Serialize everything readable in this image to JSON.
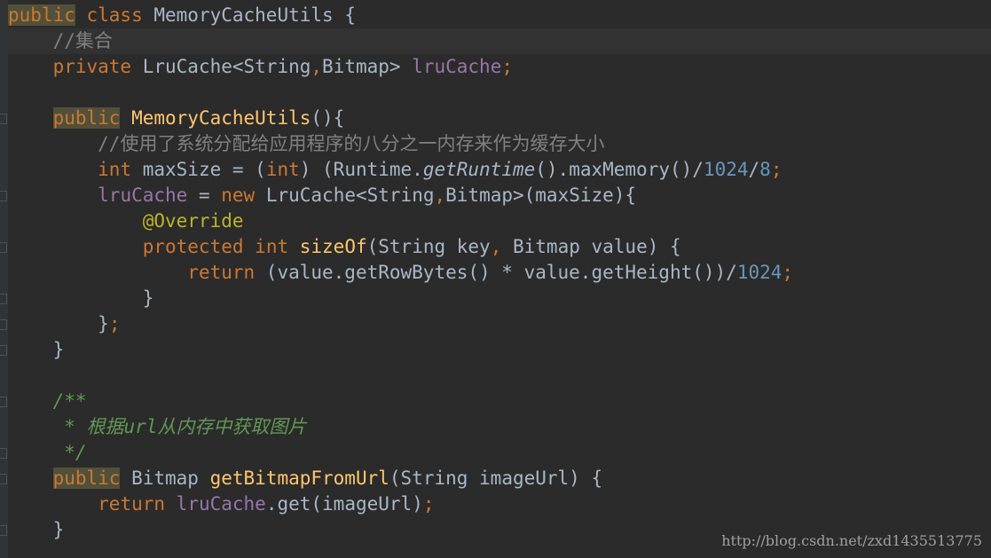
{
  "code": {
    "l1": {
      "kw_public": "public",
      "kw_class": " class ",
      "cls": "MemoryCacheUtils",
      "rest": " {"
    },
    "l2": {
      "comment": "//集合"
    },
    "l3": {
      "kw_private": "private ",
      "type": "LruCache<String",
      "comma": ",",
      "type2": "Bitmap> ",
      "field": "lruCache",
      "semi": ";"
    },
    "l4": {
      "text": ""
    },
    "l5": {
      "kw_public": "public",
      "ctor": " MemoryCacheUtils",
      "rest": "(){"
    },
    "l6": {
      "comment": "//使用了系统分配给应用程序的八分之一内存来作为缓存大小"
    },
    "l7": {
      "kw_int": "int",
      "p1": " maxSize = (",
      "kw_int2": "int",
      "p2": ") (Runtime.",
      "call": "getRuntime",
      "p3": "().maxMemory()/",
      "n1": "1024",
      "slash": "/",
      "n2": "8",
      "semi": ";"
    },
    "l8": {
      "field": "lruCache",
      "p1": " = ",
      "kw_new": "new",
      "p2": " LruCache<String",
      "comma": ",",
      "p3": "Bitmap>(maxSize){"
    },
    "l9": {
      "ann": "@Override"
    },
    "l10": {
      "kw_protected": "protected",
      "sp": " ",
      "kw_int": "int",
      "fn": " sizeOf",
      "p1": "(String key",
      "comma": ",",
      "p2": " Bitmap value) {"
    },
    "l11": {
      "kw_return": "return",
      "p1": " (value.getRowBytes() * value.getHeight())/",
      "num": "1024",
      "semi": ";"
    },
    "l12": {
      "text": "}"
    },
    "l13": {
      "brace": "}",
      "semi": ";"
    },
    "l14": {
      "text": "}"
    },
    "l15": {
      "text": ""
    },
    "l16": {
      "doc": "/**"
    },
    "l17": {
      "doc": " * 根据url从内存中获取图片"
    },
    "l18": {
      "doc": " */"
    },
    "l19": {
      "kw_public": "public",
      "p1": " Bitmap ",
      "fn": "getBitmapFromUrl",
      "p2": "(String imageUrl) {"
    },
    "l20": {
      "kw_return": "return",
      "sp": " ",
      "field": "lruCache",
      "p1": ".get(imageUrl)",
      "semi": ";"
    },
    "l21": {
      "text": "}"
    }
  },
  "watermark": "http://blog.csdn.net/zxd1435513775"
}
